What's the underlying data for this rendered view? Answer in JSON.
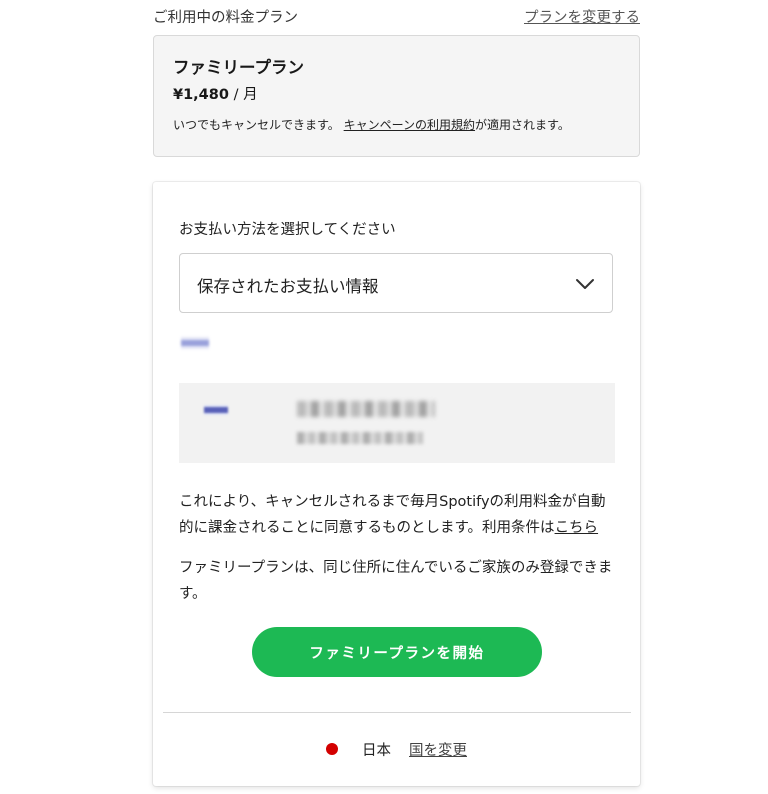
{
  "plan_header": {
    "label": "ご利用中の料金プラン",
    "change_link": "プランを変更する"
  },
  "plan": {
    "name": "ファミリープラン",
    "price": "¥1,480",
    "period": " / 月",
    "note_prefix": "いつでもキャンセルできます。",
    "terms_link": "キャンペーンの利用規約",
    "note_suffix": "が適用されます。"
  },
  "payment": {
    "label": "お支払い方法を選択してください",
    "selected_option": "保存されたお支払い情報"
  },
  "agreement": {
    "text": "これにより、キャンセルされるまで毎月Spotifyの利用料金が自動的に課金されることに同意するものとします。利用条件は",
    "link": "こちら"
  },
  "family_note": "ファミリープランは、同じ住所に住んでいるご家族のみ登録できます。",
  "cta_label": "ファミリープランを開始",
  "footer": {
    "country": "日本",
    "change_country": "国を変更"
  },
  "icons": {
    "dropdown": "chevron-down-icon",
    "flag": "japan-flag-icon",
    "card_brand": "card-brand-icon"
  },
  "colors": {
    "accent_green": "#1db954",
    "flag_red": "#d30000"
  }
}
